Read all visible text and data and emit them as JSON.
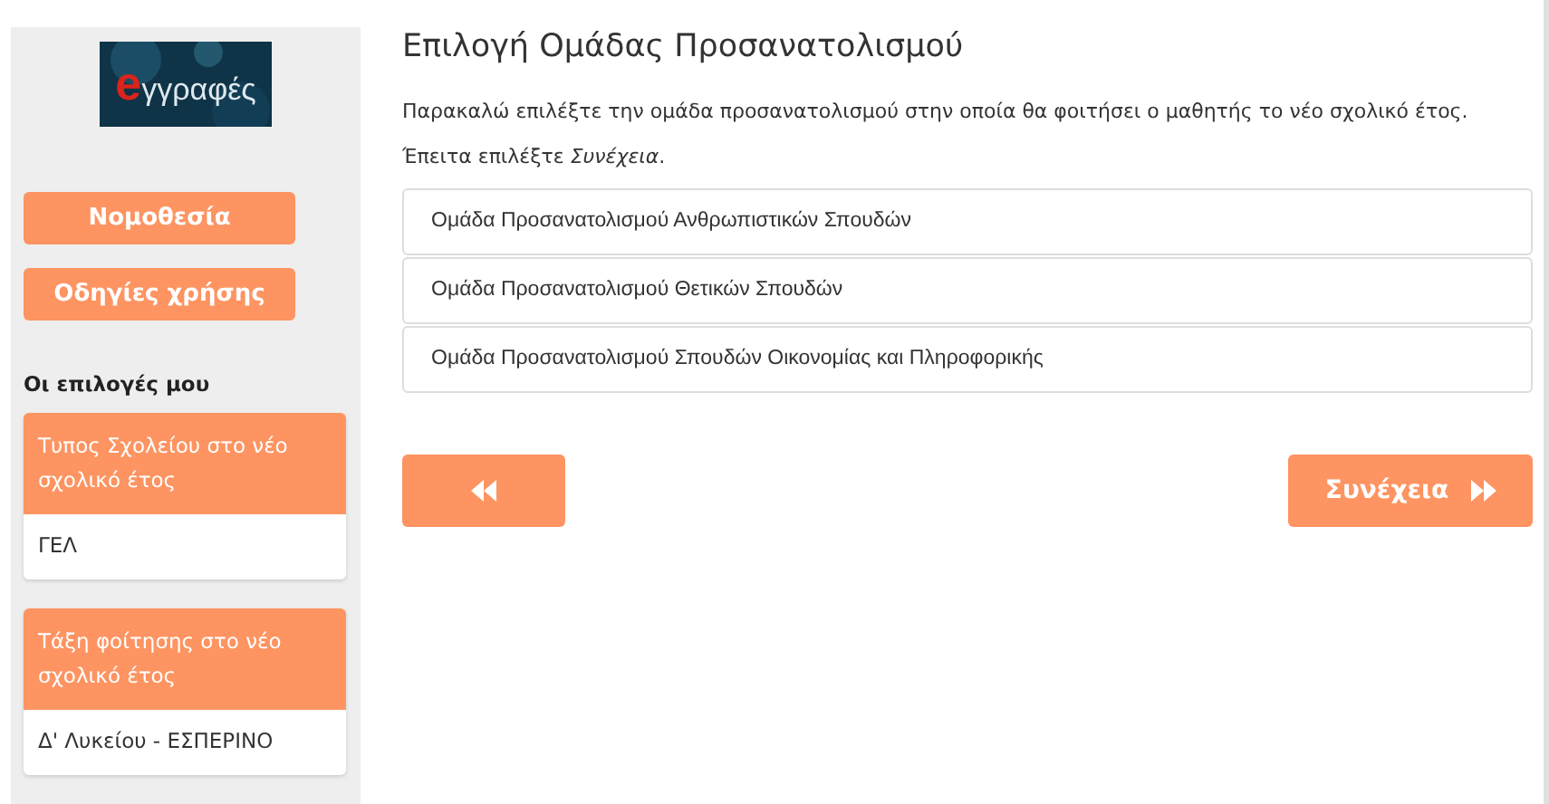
{
  "sidebar": {
    "logo": {
      "mark": "e",
      "text": "γγραφές"
    },
    "buttons": [
      "Νομοθεσία",
      "Οδηγίες χρήσης"
    ],
    "choices_title": "Οι επιλογές μου",
    "choices": [
      {
        "label": "Τυπος Σχολείου στο νέο σχολικό έτος",
        "value": "ΓΕΛ"
      },
      {
        "label": "Τάξη φοίτησης στο νέο σχολικό έτος",
        "value": "Δ' Λυκείου - ΕΣΠΕΡΙΝΟ"
      }
    ]
  },
  "main": {
    "title": "Επιλογή Ομάδας Προσανατολισμού",
    "instructions": "Παρακαλώ επιλέξτε την ομάδα προσανατολισμού στην οποία θα φοιτήσει ο μαθητής το νέο σχολικό έτος. Έπειτα επιλέξτε *Συνέχεια*.",
    "options": [
      "Ομάδα Προσανατολισμού Ανθρωπιστικών Σπουδών",
      "Ομάδα Προσανατολισμού Θετικών Σπουδών",
      "Ομάδα Προσανατολισμού Σπουδών Οικονομίας και Πληροφορικής"
    ],
    "next_button": "Συνέχεια"
  }
}
